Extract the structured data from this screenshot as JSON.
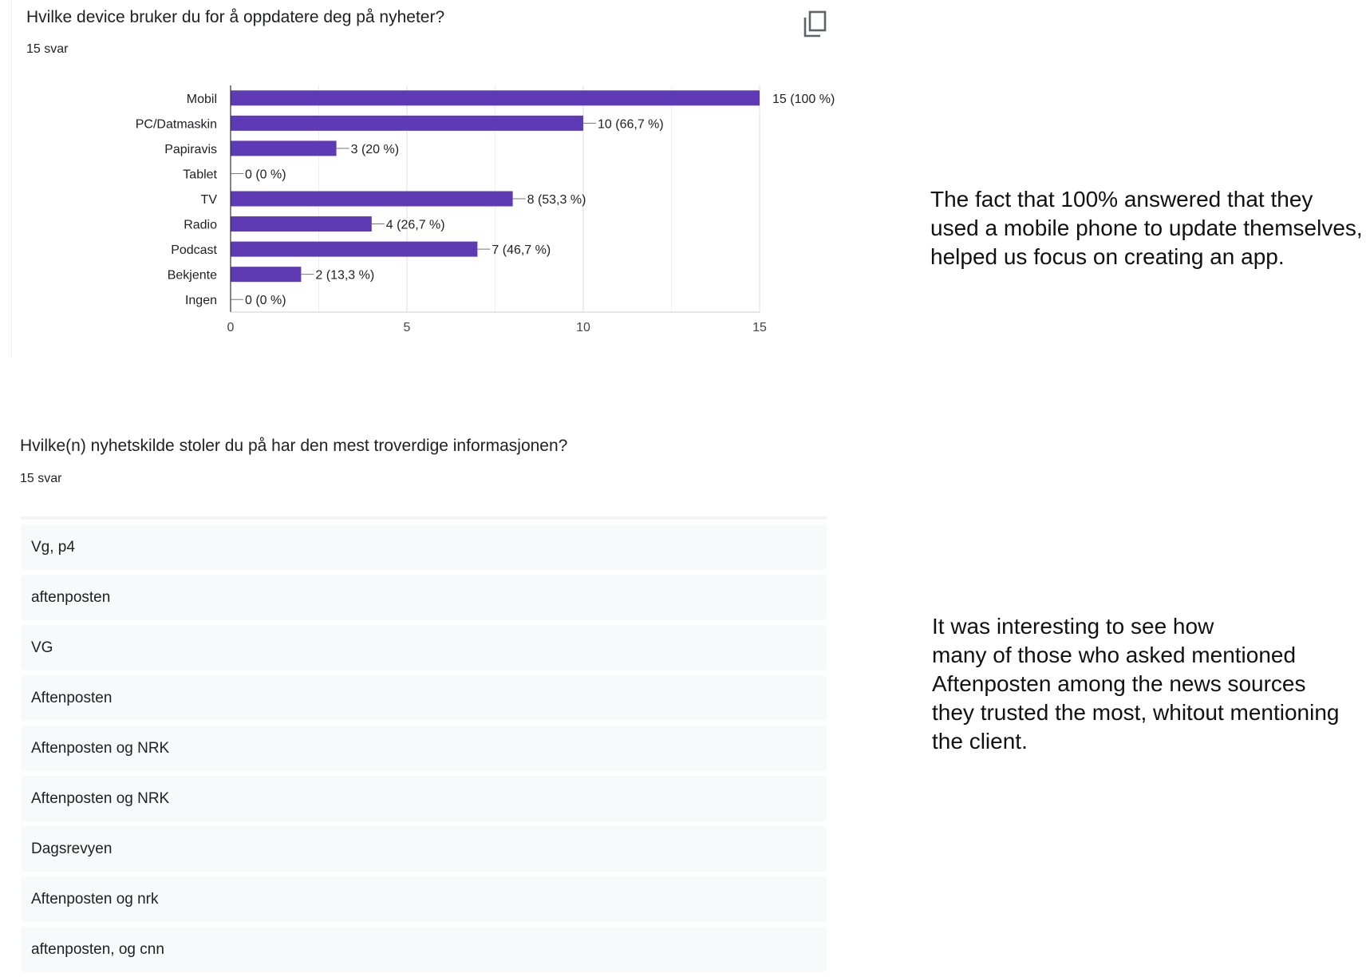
{
  "question1": {
    "title": "Hvilke device bruker du for å oppdatere deg på nyheter?",
    "count": "15 svar",
    "copy_icon": "copy-icon"
  },
  "chart_data": {
    "type": "bar",
    "orientation": "horizontal",
    "categories": [
      "Mobil",
      "PC/Datmaskin",
      "Papiravis",
      "Tablet",
      "TV",
      "Radio",
      "Podcast",
      "Bekjente",
      "Ingen"
    ],
    "values": [
      15,
      10,
      3,
      0,
      8,
      4,
      7,
      2,
      0
    ],
    "data_labels": [
      "15 (100 %)",
      "10 (66,7 %)",
      "3 (20 %)",
      "0 (0 %)",
      "8 (53,3 %)",
      "4 (26,7 %)",
      "7 (46,7 %)",
      "2 (13,3 %)",
      "0 (0 %)"
    ],
    "xlim": [
      0,
      15
    ],
    "xticks": [
      0,
      5,
      10,
      15
    ],
    "grid": true,
    "bar_color": "#5e3ab4"
  },
  "annotation1": {
    "lines": [
      "The fact that 100% answered that they",
      "used a mobile phone to update themselves,",
      "helped us focus on creating an app."
    ]
  },
  "question2": {
    "title": "Hvilke(n) nyhetskilde stoler du på har den mest troverdige informasjonen?",
    "count": "15 svar",
    "responses": [
      "Vg, p4",
      "aftenposten",
      "VG",
      "Aftenposten",
      "Aftenposten og NRK",
      "Aftenposten og NRK",
      "Dagsrevyen",
      "Aftenposten og nrk",
      "aftenposten, og cnn"
    ]
  },
  "annotation2": {
    "lines": [
      "It was interesting to see how",
      "many of those who asked mentioned",
      "Aftenposten among the news sources",
      "they trusted the most, whitout mentioning",
      "the client."
    ]
  }
}
